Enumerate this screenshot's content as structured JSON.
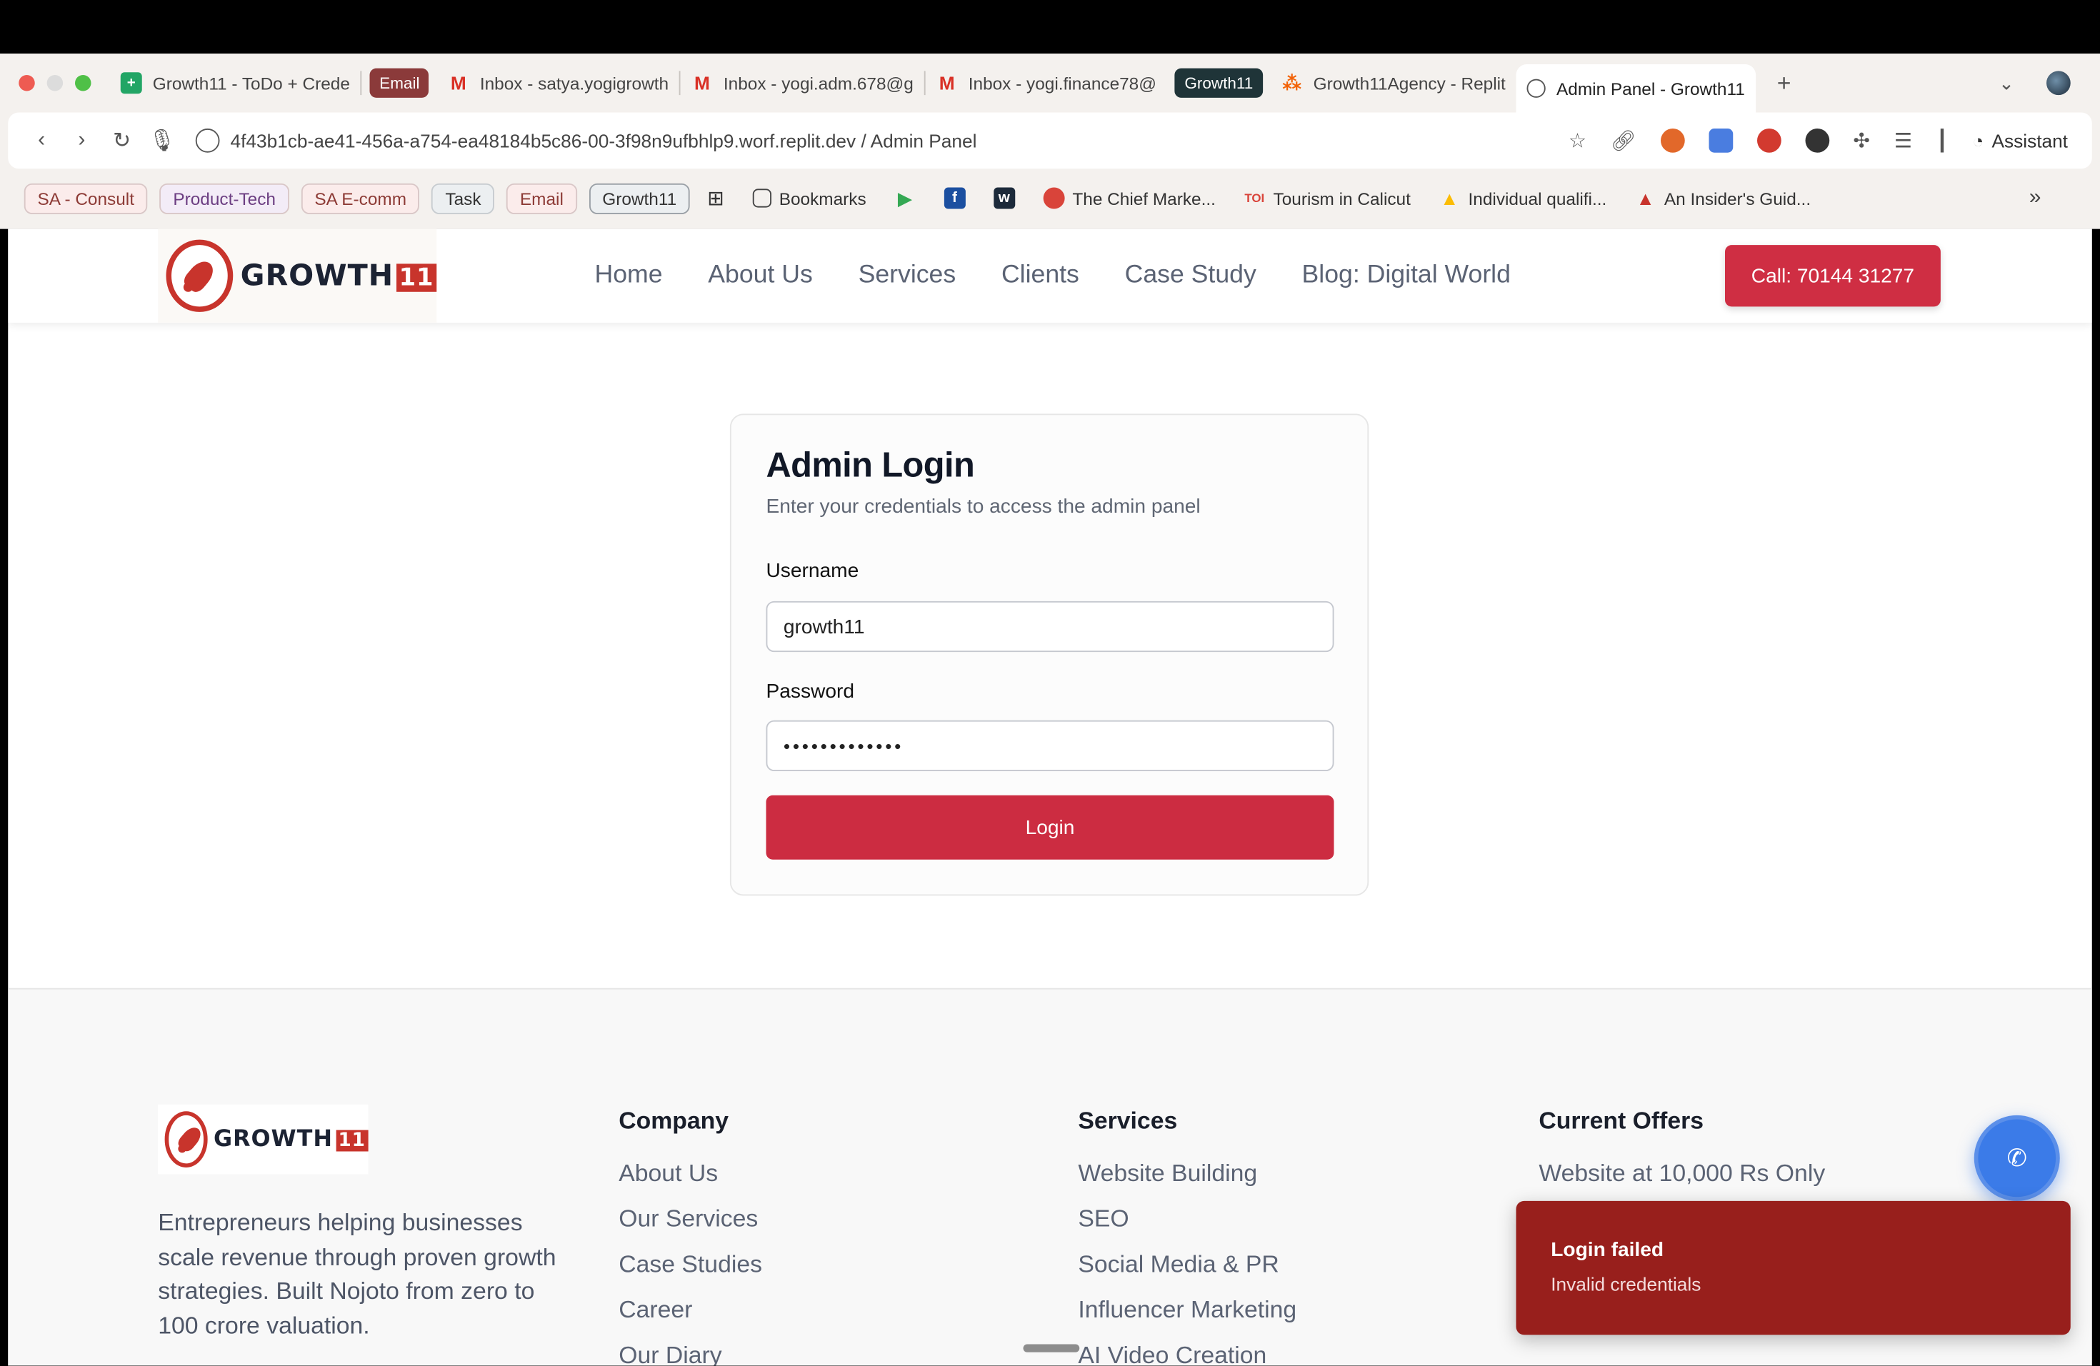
{
  "browser": {
    "tabs": [
      {
        "title": "Growth11 - ToDo + Crede",
        "icon": "sheets-icon"
      },
      {
        "group": "Email",
        "group_color": "#8b3a3a"
      },
      {
        "title": "Inbox - satya.yogigrowth",
        "icon": "gmail-icon"
      },
      {
        "title": "Inbox - yogi.adm.678@g",
        "icon": "gmail-icon"
      },
      {
        "title": "Inbox - yogi.finance78@",
        "icon": "gmail-icon"
      },
      {
        "group": "Growth11",
        "group_color": "#1f3438"
      },
      {
        "title": "Growth11Agency - Replit",
        "icon": "replit-icon"
      },
      {
        "title": "Admin Panel - Growth11",
        "icon": "globe-icon",
        "active": true
      }
    ],
    "url": "4f43b1cb-ae41-456a-a754-ea48184b5c86-00-3f98n9ufbhlp9.worf.replit.dev / Admin Panel",
    "assistant_label": "Assistant",
    "bookmarks": {
      "chips": [
        "SA - Consult",
        "Product-Tech",
        "SA E-comm",
        "Task",
        "Email",
        "Growth11"
      ],
      "items": [
        "Bookmarks",
        "The Chief Marke...",
        "Tourism in Calicut",
        "Individual qualifi...",
        "An Insider's Guid..."
      ],
      "toi_label": "TOI"
    }
  },
  "site": {
    "brand": {
      "word": "GROWTH",
      "num": "11"
    },
    "nav": [
      "Home",
      "About Us",
      "Services",
      "Clients",
      "Case Study",
      "Blog: Digital World"
    ],
    "call_button": "Call: 70144 31277",
    "accent": "#cc2c41"
  },
  "login": {
    "title": "Admin Login",
    "subtitle": "Enter your credentials to access the admin panel",
    "username_label": "Username",
    "username_value": "growth11",
    "password_label": "Password",
    "password_value": "•••••••••••••",
    "submit": "Login"
  },
  "footer": {
    "description": "Entrepreneurs helping businesses scale revenue through proven growth strategies. Built Nojoto from zero to 100 crore valuation.",
    "company": {
      "title": "Company",
      "items": [
        "About Us",
        "Our Services",
        "Case Studies",
        "Career",
        "Our Diary"
      ]
    },
    "services": {
      "title": "Services",
      "items": [
        "Website Building",
        "SEO",
        "Social Media & PR",
        "Influencer Marketing",
        "AI Video Creation"
      ]
    },
    "offers": {
      "title": "Current Offers",
      "items": [
        "Website at 10,000 Rs Only"
      ]
    }
  },
  "toast": {
    "title": "Login failed",
    "message": "Invalid credentials",
    "color": "#981f1c"
  }
}
